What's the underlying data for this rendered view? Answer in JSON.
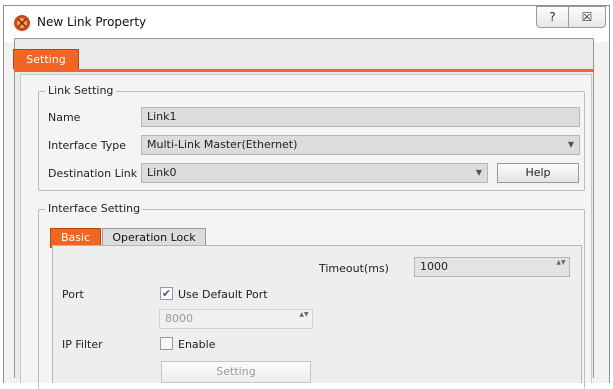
{
  "window": {
    "title": "New Link Property",
    "help_glyph": "?",
    "close_glyph": "☒"
  },
  "tabs": {
    "main": "Setting"
  },
  "link_setting": {
    "legend": "Link Setting",
    "name_label": "Name",
    "name_value": "Link1",
    "interface_type_label": "Interface Type",
    "interface_type_value": "Multi-Link Master(Ethernet)",
    "destination_label": "Destination Link",
    "destination_value": "Link0",
    "help_button": "Help",
    "dropdown_glyph": "▼"
  },
  "interface_setting": {
    "legend": "Interface Setting",
    "tabs": [
      "Basic",
      "Operation Lock"
    ],
    "timeout_label": "Timeout(ms)",
    "timeout_value": "1000",
    "port_label": "Port",
    "use_default_port_label": "Use Default Port",
    "use_default_port_checked": true,
    "checkmark_glyph": "✔",
    "spin_glyph": "▲▼",
    "port_value": "8000",
    "ip_filter_label": "IP Filter",
    "enable_label": "Enable",
    "enable_checked": false,
    "setting_button": "Setting"
  },
  "colors": {
    "accent": "#f26522",
    "field_bg": "#dcdcdc"
  }
}
